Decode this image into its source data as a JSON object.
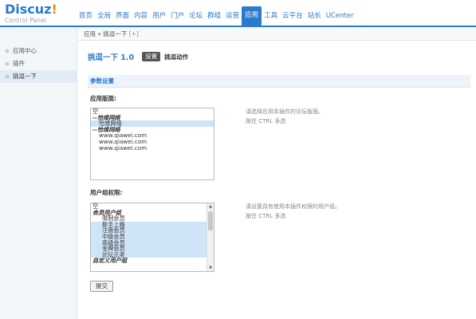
{
  "brand": {
    "name": "Discuz",
    "exclaim": "!",
    "sub": "Control Panel"
  },
  "nav": [
    "首页",
    "全局",
    "界面",
    "内容",
    "用户",
    "门户",
    "论坛",
    "群组",
    "运营",
    "应用",
    "工具",
    "云平台",
    "站长",
    "UCenter"
  ],
  "nav_active_index": 9,
  "sidebar": [
    {
      "label": "应用中心",
      "active": false
    },
    {
      "label": "插件",
      "active": false
    },
    {
      "label": "挑逗一下",
      "active": true
    }
  ],
  "breadcrumb": {
    "text": "应用 » 挑逗一下",
    "plus": "[+]"
  },
  "plugin": {
    "title": "挑逗一下  1.0",
    "tab_settings": "设置",
    "tab_action": "挑逗动作"
  },
  "section_title": "参数设置",
  "forum_field": {
    "label": "应用版面:",
    "options": [
      {
        "text": "空",
        "type": "plain",
        "selected": false
      },
      {
        "text": "--恰维网络",
        "type": "grp",
        "selected": false
      },
      {
        "text": "恰维网络",
        "type": "ind",
        "selected": true
      },
      {
        "text": "--恰维网络",
        "type": "grp",
        "selected": false
      },
      {
        "text": "www.qiawei.com",
        "type": "ind",
        "selected": false
      },
      {
        "text": "www.qiawei.com",
        "type": "ind",
        "selected": false
      },
      {
        "text": "www.qiawei.com",
        "type": "ind",
        "selected": false
      }
    ],
    "hint1": "请选择应用本插件的论坛版面。",
    "hint2": "按住 CTRL 多选"
  },
  "group_field": {
    "label": "用户组权限:",
    "options": [
      {
        "text": "空",
        "type": "plain",
        "selected": false
      },
      {
        "text": "会员用户组",
        "type": "grp",
        "selected": false
      },
      {
        "text": "限制会员",
        "type": "ind2",
        "selected": false
      },
      {
        "text": "新手上路",
        "type": "ind2",
        "selected": true
      },
      {
        "text": "注册会员",
        "type": "ind2",
        "selected": true
      },
      {
        "text": "中级会员",
        "type": "ind2",
        "selected": true
      },
      {
        "text": "高级会员",
        "type": "ind2",
        "selected": true
      },
      {
        "text": "金牌会员",
        "type": "ind2",
        "selected": true
      },
      {
        "text": "论坛元老",
        "type": "ind2",
        "selected": true
      },
      {
        "text": "自定义用户组",
        "type": "grp",
        "selected": false
      }
    ],
    "hint1": "请设置具有使用本插件权限的用户组。",
    "hint2": "按住 CTRL 多选"
  },
  "submit_label": "提交",
  "colors": {
    "accent": "#2b7acd",
    "brand_exclaim": "#f08a00",
    "selection": "#cfe5f7"
  }
}
